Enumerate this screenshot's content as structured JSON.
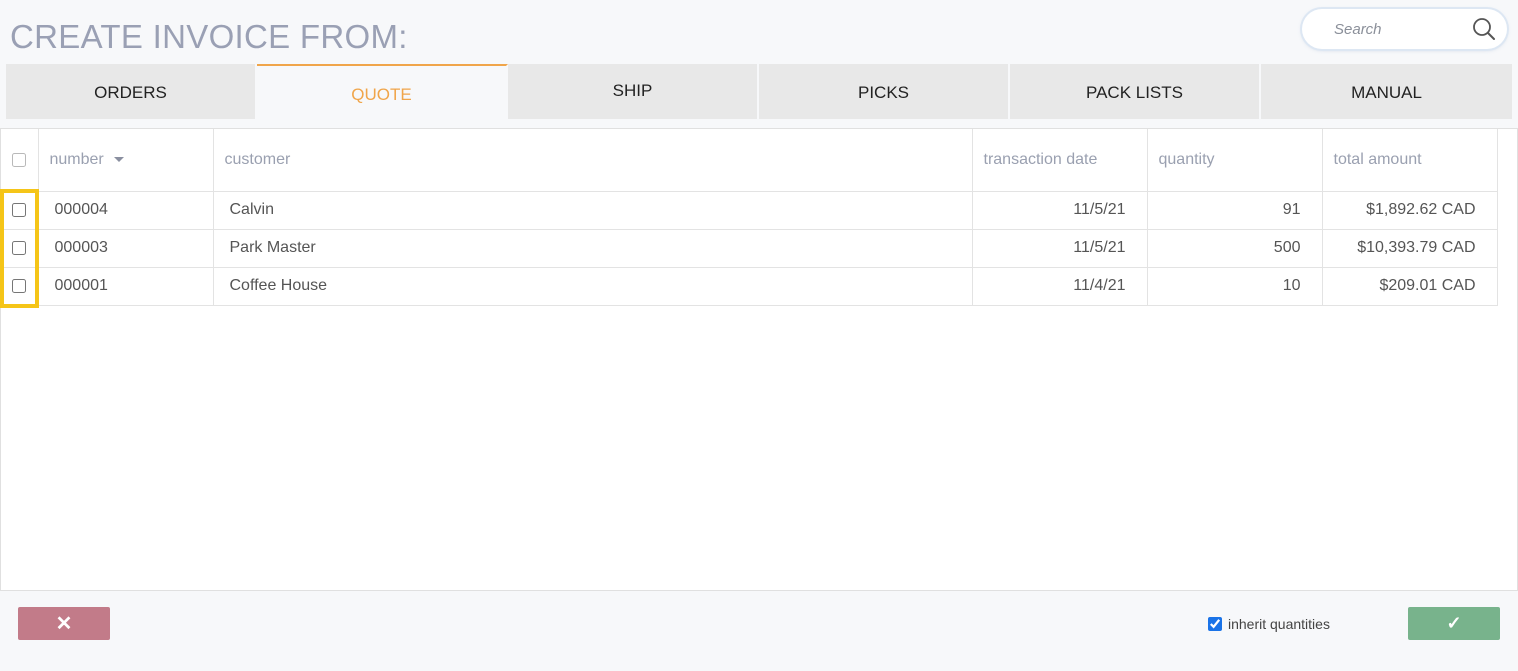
{
  "page_title": "CREATE INVOICE FROM:",
  "search": {
    "placeholder": "Search",
    "value": ""
  },
  "tabs": [
    {
      "label": "ORDERS",
      "active": false
    },
    {
      "label": "QUOTE",
      "active": true
    },
    {
      "label": "SHIP",
      "active": false
    },
    {
      "label": "PICKS",
      "active": false
    },
    {
      "label": "PACK LISTS",
      "active": false
    },
    {
      "label": "MANUAL",
      "active": false
    }
  ],
  "table": {
    "columns": {
      "number": "number",
      "customer": "customer",
      "transaction_date": "transaction date",
      "quantity": "quantity",
      "total_amount": "total amount"
    },
    "sort": {
      "column": "number",
      "direction": "descending"
    },
    "rows": [
      {
        "number": "000004",
        "customer": "Calvin",
        "transaction_date": "11/5/21",
        "quantity": "91",
        "total_amount": "$1,892.62 CAD",
        "checked": false
      },
      {
        "number": "000003",
        "customer": "Park Master",
        "transaction_date": "11/5/21",
        "quantity": "500",
        "total_amount": "$10,393.79 CAD",
        "checked": false
      },
      {
        "number": "000001",
        "customer": "Coffee House",
        "transaction_date": "11/4/21",
        "quantity": "10",
        "total_amount": "$209.01 CAD",
        "checked": false
      }
    ]
  },
  "footer": {
    "cancel_label": "✕",
    "confirm_label": "✓",
    "inherit_quantities": {
      "label": "inherit quantities",
      "checked": true
    }
  },
  "colors": {
    "accent": "#f0a54a",
    "title": "#9aa0b4",
    "cancel": "#c27b89",
    "confirm": "#78b38c",
    "highlight": "#f5c518"
  }
}
